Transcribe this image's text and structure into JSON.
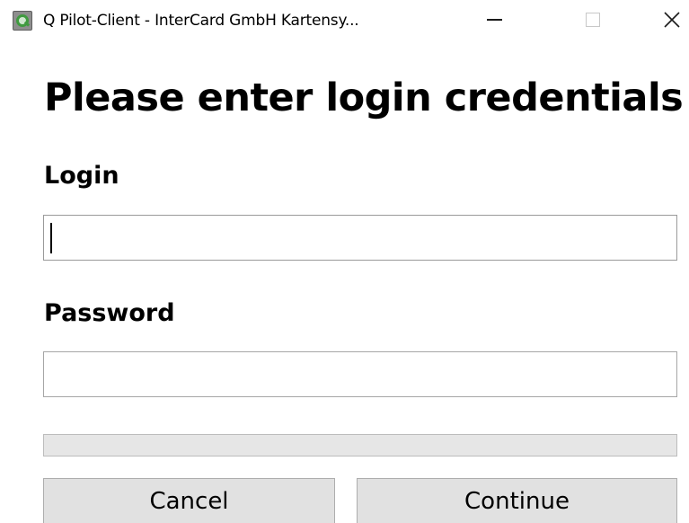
{
  "window": {
    "title": "Q Pilot-Client - InterCard GmbH Kartensy...",
    "icon": "app-logo-icon",
    "controls": {
      "minimize_icon": "minimize-icon",
      "maximize_icon": "maximize-icon",
      "close_glyph": "✕",
      "close_icon": "close-icon"
    }
  },
  "form": {
    "heading": "Please enter login credentials",
    "login": {
      "label": "Login",
      "value": "",
      "placeholder": ""
    },
    "password": {
      "label": "Password",
      "value": "",
      "placeholder": ""
    },
    "progress": {
      "value_percent": 0
    },
    "buttons": {
      "cancel": "Cancel",
      "continue": "Continue"
    }
  },
  "colors": {
    "progress_track": "#e6e6e6",
    "progress_fill": "#06b025",
    "button_face": "#e1e1e1",
    "input_border": "#a6a6a6"
  }
}
